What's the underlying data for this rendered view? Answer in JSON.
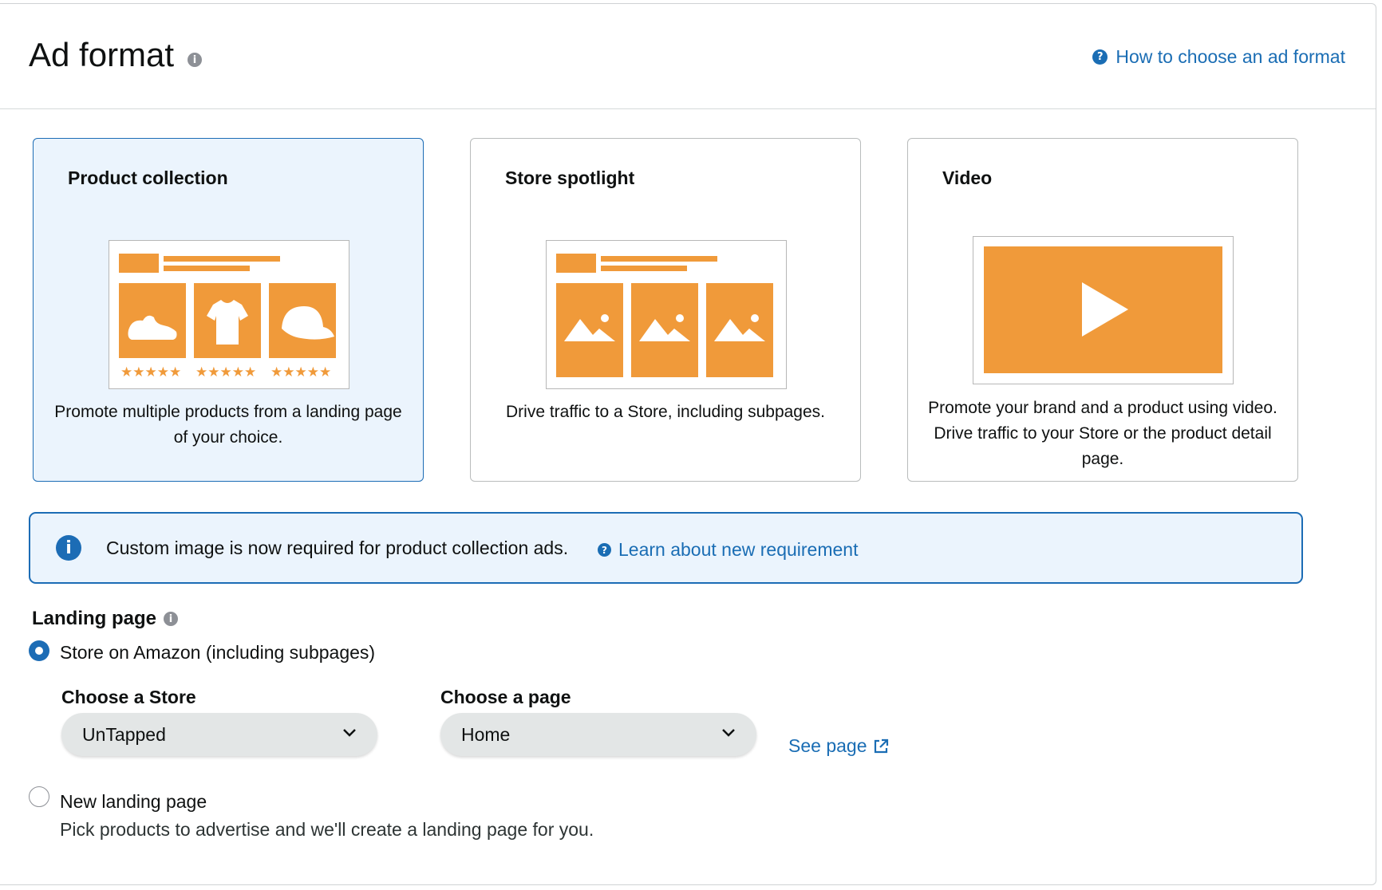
{
  "header": {
    "title": "Ad format",
    "info_icon": "info-circle-icon",
    "help_link": "How to choose an ad format",
    "help_icon": "question-circle-icon"
  },
  "cards": [
    {
      "title": "Product collection",
      "description": "Promote multiple products from a landing page of your choice.",
      "selected": true
    },
    {
      "title": "Store spotlight",
      "description": "Drive traffic to a Store, including subpages.",
      "selected": false
    },
    {
      "title": "Video",
      "description": "Promote your brand and a product using video. Drive traffic to your Store or the product detail page.",
      "selected": false
    }
  ],
  "illustration": {
    "product_icons": [
      "shoe-icon",
      "tshirt-icon",
      "cap-icon"
    ],
    "rating_stars": "★★★★★",
    "store_icons": [
      "image-icon",
      "image-icon",
      "image-icon"
    ],
    "video_icon": "play-icon"
  },
  "banner": {
    "text": "Custom image is now required for product collection ads.",
    "link": "Learn about new requirement"
  },
  "landing_page": {
    "heading": "Landing page",
    "option_store": "Store on Amazon (including subpages)",
    "store_label": "Choose a Store",
    "store_value": "UnTapped",
    "page_label": "Choose a page",
    "page_value": "Home",
    "see_page": "See page",
    "option_new": "New landing page",
    "option_new_sub": "Pick products to advertise and we'll create a landing page for you.",
    "selected_option": "store"
  },
  "colors": {
    "accent_orange": "#f09a3a",
    "link_blue": "#1a6db4",
    "selected_bg": "#ebf4fd",
    "info_gray": "#8d9096"
  }
}
